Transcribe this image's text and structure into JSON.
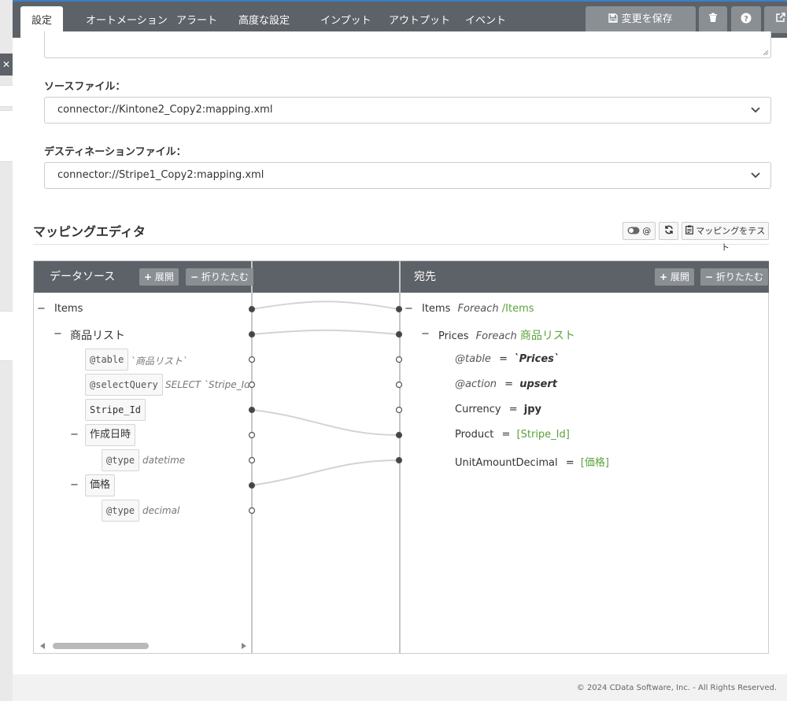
{
  "tabs": [
    "設定",
    "オートメーション",
    "アラート",
    "高度な設定",
    "インプット",
    "アウトプット",
    "イベント"
  ],
  "toolbar": {
    "save_label": "変更を保存"
  },
  "fields": {
    "source_label": "ソースファイル：",
    "source_value": "connector://Kintone2_Copy2:mapping.xml",
    "dest_label": "デスティネーションファイル：",
    "dest_value": "connector://Stripe1_Copy2:mapping.xml"
  },
  "editor": {
    "title": "マッピングエディタ",
    "toggle_label": "@",
    "test_label": "マッピングをテスト",
    "source": {
      "title": "データソース",
      "expand": "展開",
      "collapse": "折りたたむ",
      "items_label": "Items",
      "list_label": "商品リスト",
      "table_attr": "@table",
      "table_value": "`商品リスト`",
      "selectquery_attr": "@selectQuery",
      "selectquery_value": "SELECT `Stripe_Id",
      "stripe_id": "Stripe_Id",
      "created": "作成日時",
      "type_attr": "@type",
      "created_type": "datetime",
      "price": "価格",
      "price_type": "decimal"
    },
    "dest": {
      "title": "宛先",
      "expand": "展開",
      "collapse": "折りたたむ",
      "items_label": "Items",
      "foreach": "Foreach",
      "items_path": "/Items",
      "prices_label": "Prices",
      "prices_path": "商品リスト",
      "table_attr": "@table",
      "table_value": "`Prices`",
      "action_attr": "@action",
      "action_value": "upsert",
      "currency_label": "Currency",
      "currency_value": "jpy",
      "product_label": "Product",
      "product_value": "[Stripe_Id]",
      "amount_label": "UnitAmountDecimal",
      "amount_value": "[価格]",
      "eq": "="
    }
  },
  "footer": "© 2024 CData Software, Inc. - All Rights Reserved.",
  "colors": {
    "header": "#5d6268",
    "accent": "#3b7fc4",
    "mapped": "#5aa33a"
  },
  "icons": [
    "save-icon",
    "trash-icon",
    "help-icon",
    "external-link-icon",
    "toggle-icon",
    "refresh-icon",
    "clipboard-icon",
    "plus-icon",
    "minus-icon",
    "chevron-down-icon"
  ]
}
